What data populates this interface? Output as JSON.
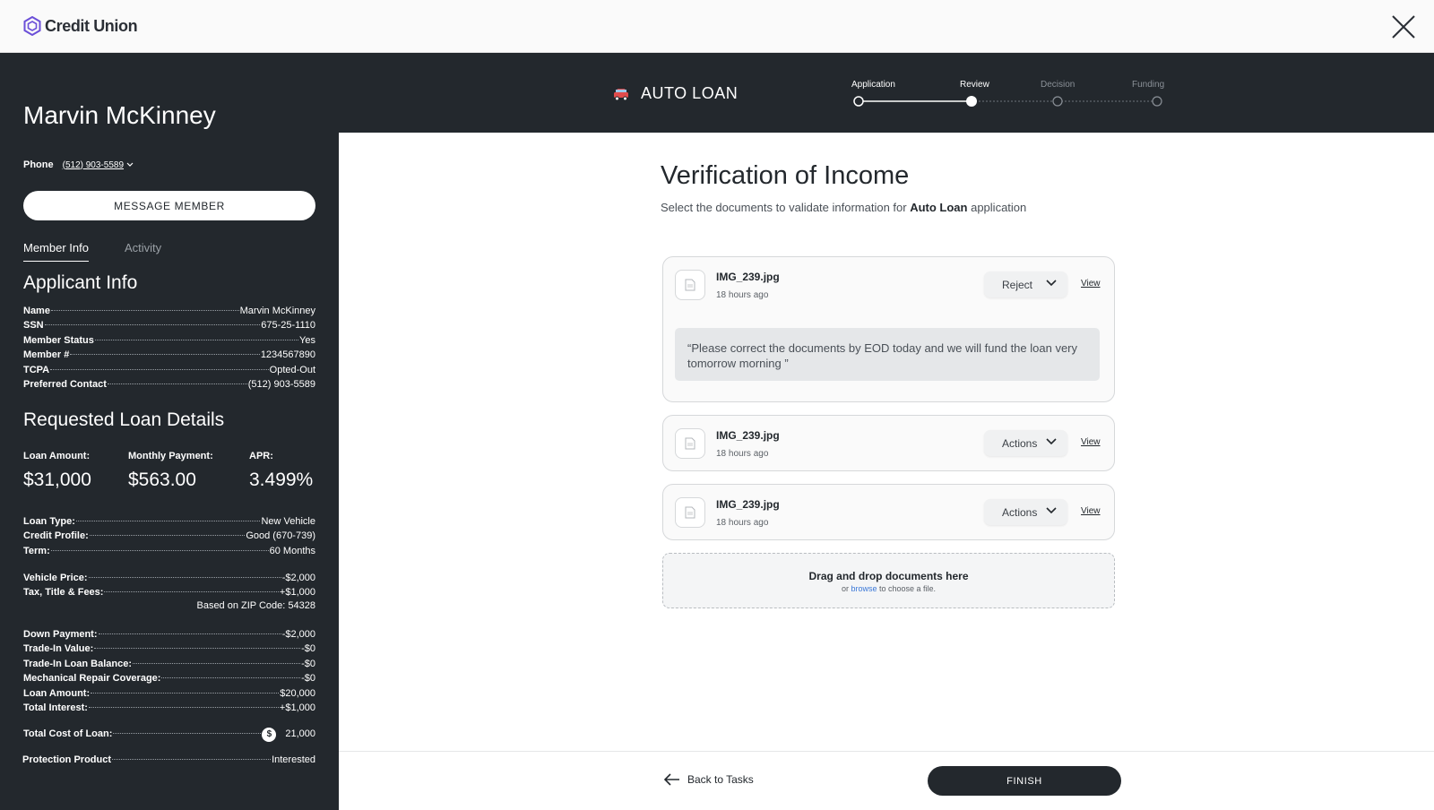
{
  "brand": {
    "name": "Credit Union",
    "accent": "#6b4fd8"
  },
  "header": {
    "loan_type": "AUTO LOAN",
    "loan_icon": "car-icon"
  },
  "stepper": {
    "steps": [
      {
        "label": "Application",
        "state": "complete"
      },
      {
        "label": "Review",
        "state": "current"
      },
      {
        "label": "Decision",
        "state": "pending"
      },
      {
        "label": "Funding",
        "state": "pending"
      }
    ]
  },
  "member": {
    "name": "Marvin McKinney",
    "phone_label": "Phone",
    "phone": "(512) 903-5589",
    "message_button": "MESSAGE MEMBER"
  },
  "tabs": {
    "member_info": "Member Info",
    "activity": "Activity"
  },
  "applicant": {
    "title": "Applicant Info",
    "rows": [
      {
        "label": "Name",
        "value": "Marvin McKinney"
      },
      {
        "label": "SSN",
        "value": "675-25-1110"
      },
      {
        "label": "Member Status",
        "value": "Yes"
      },
      {
        "label": "Member #",
        "value": "1234567890"
      },
      {
        "label": "TCPA",
        "value": "Opted-Out"
      },
      {
        "label": "Preferred Contact",
        "value": "(512) 903-5589"
      }
    ]
  },
  "loan": {
    "title": "Requested Loan Details",
    "amount_label": "Loan Amount:",
    "amount": "$31,000",
    "payment_label": "Monthly Payment:",
    "payment": "$563.00",
    "apr_label": "APR:",
    "apr": "3.499%",
    "details": [
      {
        "label": "Loan Type:",
        "value": "New Vehicle"
      },
      {
        "label": "Credit Profile:",
        "value": "Good (670-739)"
      },
      {
        "label": "Term:",
        "value": "60 Months"
      }
    ],
    "pricing": [
      {
        "label": "Vehicle Price:",
        "value": "-$2,000"
      },
      {
        "label": "Tax, Title & Fees:",
        "value": "+$1,000"
      }
    ],
    "zip_note": "Based on ZIP Code: 54328",
    "breakdown": [
      {
        "label": "Down Payment:",
        "value": "-$2,000"
      },
      {
        "label": "Trade-In Value:",
        "value": "-$0"
      },
      {
        "label": "Trade-In Loan Balance:",
        "value": "-$0"
      },
      {
        "label": "Mechanical Repair Coverage:",
        "value": "-$0"
      },
      {
        "label": "Loan Amount:",
        "value": "$20,000"
      },
      {
        "label": "Total Interest:",
        "value": "+$1,000"
      }
    ],
    "total_label": "Total Cost of Loan:",
    "total_value": "21,000",
    "protection_label": "Protection Product",
    "protection_value": "Interested"
  },
  "main": {
    "title": "Verification of Income",
    "subtitle_pre": "Select the documents to validate information for ",
    "subtitle_bold": "Auto Loan",
    "subtitle_post": " application",
    "documents": [
      {
        "name": "IMG_239.jpg",
        "time": "18 hours ago",
        "action": "Reject",
        "view": "View",
        "comment": "“Please correct the documents by EOD today and we will fund the loan very tomorrow morning ”"
      },
      {
        "name": "IMG_239.jpg",
        "time": "18 hours ago",
        "action": "Actions",
        "view": "View"
      },
      {
        "name": "IMG_239.jpg",
        "time": "18 hours ago",
        "action": "Actions",
        "view": "View"
      }
    ],
    "dropzone": {
      "title": "Drag and drop documents here",
      "pre": "or ",
      "browse": "browse",
      "post": " to choose a file."
    }
  },
  "footer": {
    "back": "Back to Tasks",
    "finish": "FINISH"
  }
}
